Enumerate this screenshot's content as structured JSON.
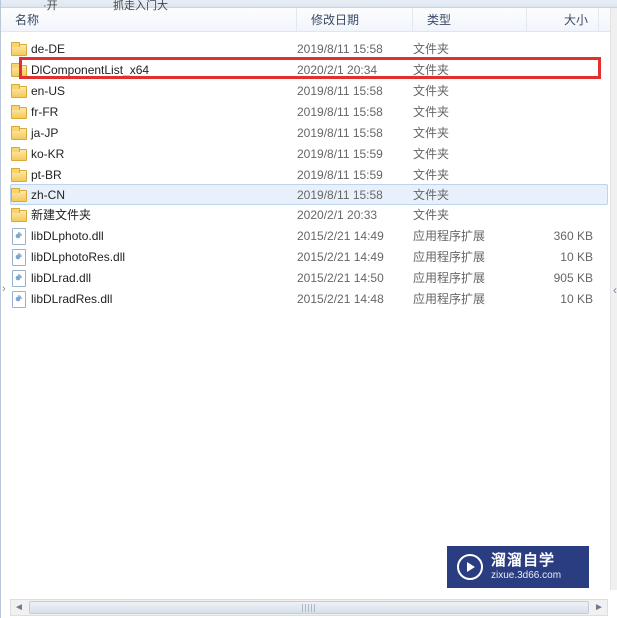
{
  "toolbar": {
    "fragment_left": "·开",
    "fragment_right": "抓走入门大"
  },
  "columns": {
    "name": "名称",
    "date": "修改日期",
    "type": "类型",
    "size": "大小"
  },
  "types": {
    "folder": "文件夹",
    "ext": "应用程序扩展"
  },
  "rows": [
    {
      "icon": "folder",
      "name": "de-DE",
      "date": "2019/8/11 15:58",
      "type": "文件夹",
      "size": ""
    },
    {
      "icon": "folder",
      "name": "DlComponentList_x64",
      "date": "2020/2/1 20:34",
      "type": "文件夹",
      "size": "",
      "highlighted": true
    },
    {
      "icon": "folder",
      "name": "en-US",
      "date": "2019/8/11 15:58",
      "type": "文件夹",
      "size": ""
    },
    {
      "icon": "folder",
      "name": "fr-FR",
      "date": "2019/8/11 15:58",
      "type": "文件夹",
      "size": ""
    },
    {
      "icon": "folder",
      "name": "ja-JP",
      "date": "2019/8/11 15:58",
      "type": "文件夹",
      "size": ""
    },
    {
      "icon": "folder",
      "name": "ko-KR",
      "date": "2019/8/11 15:59",
      "type": "文件夹",
      "size": ""
    },
    {
      "icon": "folder",
      "name": "pt-BR",
      "date": "2019/8/11 15:59",
      "type": "文件夹",
      "size": ""
    },
    {
      "icon": "folder",
      "name": "zh-CN",
      "date": "2019/8/11 15:58",
      "type": "文件夹",
      "size": "",
      "selected": true
    },
    {
      "icon": "folder",
      "name": "新建文件夹",
      "date": "2020/2/1 20:33",
      "type": "文件夹",
      "size": ""
    },
    {
      "icon": "dll",
      "name": "libDLphoto.dll",
      "date": "2015/2/21 14:49",
      "type": "应用程序扩展",
      "size": "360 KB"
    },
    {
      "icon": "dll",
      "name": "libDLphotoRes.dll",
      "date": "2015/2/21 14:49",
      "type": "应用程序扩展",
      "size": "10 KB"
    },
    {
      "icon": "dll",
      "name": "libDLrad.dll",
      "date": "2015/2/21 14:50",
      "type": "应用程序扩展",
      "size": "905 KB"
    },
    {
      "icon": "dll",
      "name": "libDLradRes.dll",
      "date": "2015/2/21 14:48",
      "type": "应用程序扩展",
      "size": "10 KB"
    }
  ],
  "watermark": {
    "cn": "溜溜自学",
    "en": "zixue.3d66.com"
  }
}
